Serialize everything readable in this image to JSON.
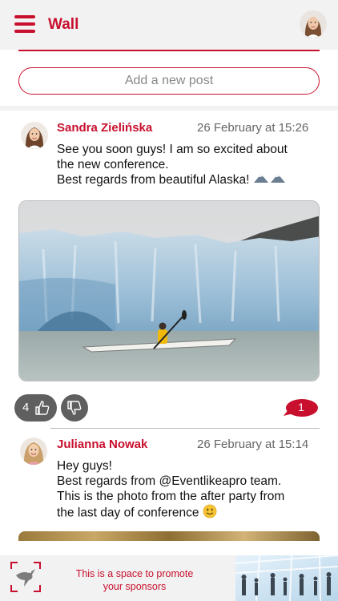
{
  "header": {
    "title": "Wall",
    "menu_icon": "hamburger-menu-icon",
    "profile_icon": "user-avatar"
  },
  "composer": {
    "placeholder": "Add a new post"
  },
  "posts": [
    {
      "author": "Sandra Zielińska",
      "date": "26 February at 15:26",
      "text_lines": [
        "See you soon guys! I am so excited about",
        "the new conference.",
        "Best regards from beautiful Alaska!"
      ],
      "emoji": "mountain-emoji",
      "photo": "glacier-kayak-photo",
      "likes": "4",
      "comments": "1"
    },
    {
      "author": "Julianna Nowak",
      "date": "26 February at 15:14",
      "text_lines": [
        "Hey guys!",
        "Best regards from @Eventlikeapro team.",
        "This is the photo from the after party from",
        "the last day of conference"
      ],
      "emoji": "smiley-emoji",
      "photo": "party-photo"
    }
  ],
  "sponsor": {
    "text_line1": "This is a space to promote",
    "text_line2": "your sponsors",
    "logo": "sponsor-bird-logo",
    "image": "sponsor-conference-photo"
  },
  "colors": {
    "accent": "#c8102e",
    "button_gray": "#5f5f5f",
    "bar_background": "#f2f2f2"
  }
}
